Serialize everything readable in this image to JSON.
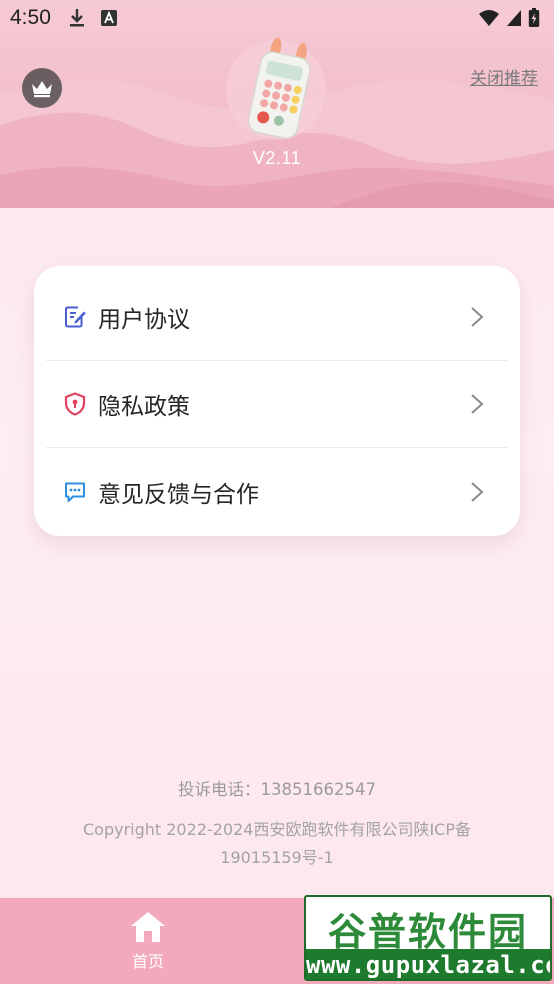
{
  "status_bar": {
    "time": "4:50",
    "icons": [
      "download-icon",
      "font-a-icon",
      "wifi-icon",
      "signal-icon",
      "battery-icon"
    ]
  },
  "header": {
    "close_recommend_label": "关闭推荐",
    "version": "V2.11",
    "crown_icon": "crown-icon",
    "app_icon": "calculator-app-icon"
  },
  "menu": {
    "items": [
      {
        "label": "用户协议",
        "icon": "document-edit-icon",
        "icon_color": "#4a5fd6"
      },
      {
        "label": "隐私政策",
        "icon": "shield-lock-icon",
        "icon_color": "#e0415e"
      },
      {
        "label": "意见反馈与合作",
        "icon": "chat-bubble-icon",
        "icon_color": "#2e8fe0"
      }
    ]
  },
  "footer": {
    "contact": "投诉电话：13851662547",
    "copyright": "Copyright 2022-2024西安欧跑软件有限公司陕ICP备19015159号-1"
  },
  "bottom_nav": {
    "items": [
      {
        "label": "首页",
        "icon": "home-icon"
      }
    ],
    "background": "#f2a9bb"
  },
  "watermark": {
    "title": "谷普软件园",
    "url": "www.gupuxlazal.com"
  },
  "colors": {
    "header_pink": "#f2bccb",
    "page_bg": "#fde8ee",
    "card_bg": "#ffffff"
  }
}
